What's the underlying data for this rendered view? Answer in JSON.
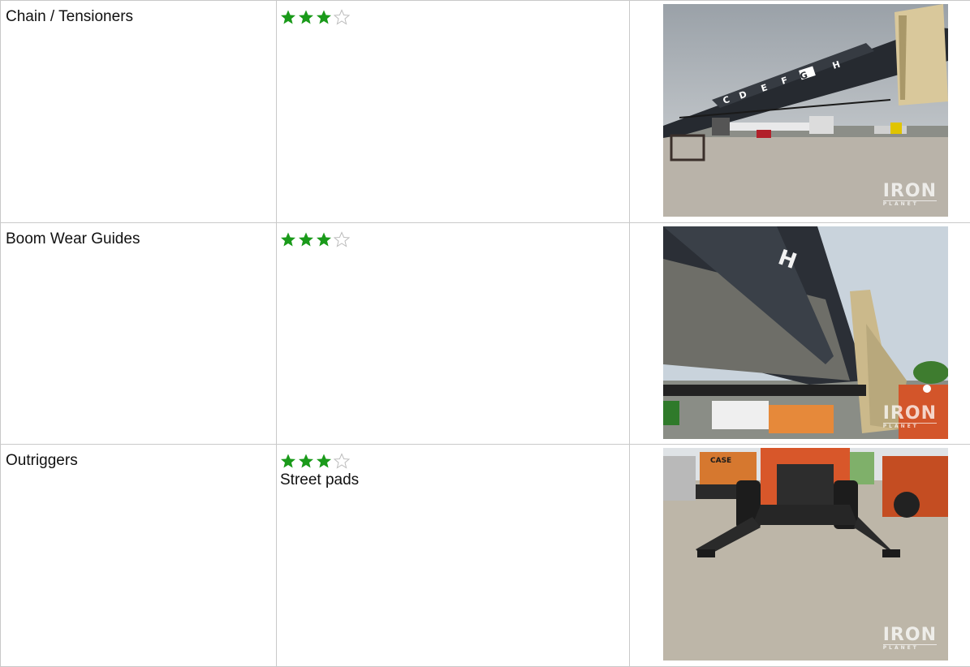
{
  "rows": [
    {
      "label": "Chain / Tensioners",
      "rating": 3,
      "max_rating": 4,
      "note": "",
      "photo": {
        "description": "boom-chain-photo",
        "watermark": "IRON",
        "watermark_sub": "PLANET",
        "boom_letters": [
          "C",
          "D",
          "E",
          "F",
          "G",
          "H"
        ]
      }
    },
    {
      "label": "Boom Wear Guides",
      "rating": 3,
      "max_rating": 4,
      "note": "",
      "photo": {
        "description": "boom-wear-guides-photo",
        "watermark": "IRON",
        "watermark_sub": "PLANET",
        "boom_letters": [
          "H"
        ]
      }
    },
    {
      "label": "Outriggers",
      "rating": 3,
      "max_rating": 4,
      "note": "Street pads",
      "photo": {
        "description": "outriggers-photo",
        "watermark": "IRON",
        "watermark_sub": "PLANET",
        "machine_text": "CASE"
      }
    }
  ],
  "colors": {
    "star_filled": "#1a9a1a",
    "star_empty_outline": "#bdbdbd",
    "border": "#c9c9c9"
  }
}
